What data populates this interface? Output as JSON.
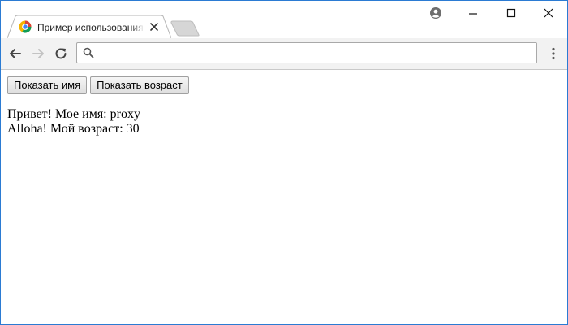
{
  "tab": {
    "title": "Пример использования Proxy"
  },
  "omnibox": {
    "value": "",
    "placeholder": ""
  },
  "page": {
    "buttons": {
      "show_name": "Показать имя",
      "show_age": "Показать возраст"
    },
    "output": [
      "Привет! Мое имя: proxy",
      "Alloha! Мой возраст: 30"
    ]
  },
  "colors": {
    "window_border": "#2b7bd3",
    "toolbar_bg": "#f2f2f2",
    "tab_bg": "#ffffff",
    "inactive_tab": "#d6d6d6"
  }
}
